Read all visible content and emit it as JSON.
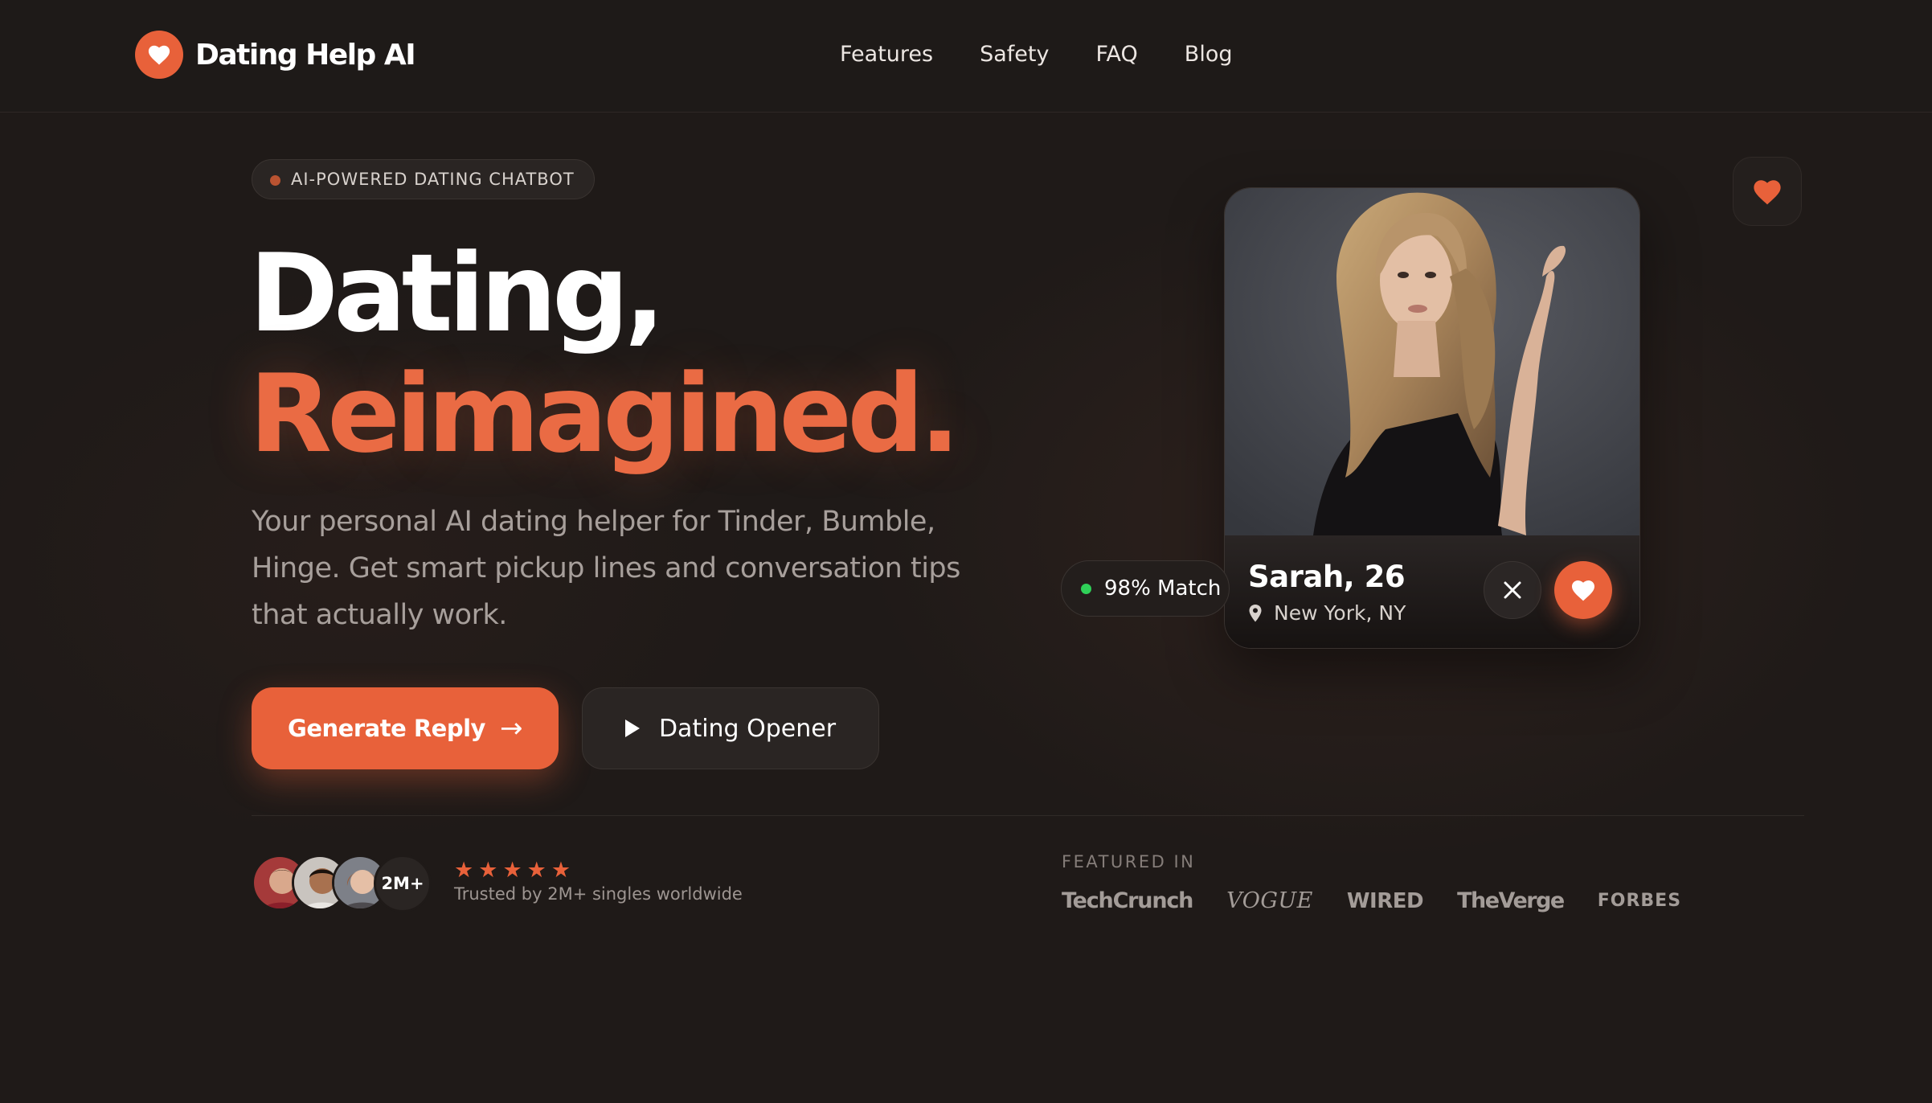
{
  "nav": {
    "brand": "Dating Help AI",
    "links": [
      "Features",
      "Safety",
      "FAQ",
      "Blog"
    ]
  },
  "hero": {
    "badge": "AI-POWERED DATING CHATBOT",
    "title_line1": "Dating,",
    "title_line2": "Reimagined.",
    "subtitle": "Your personal AI dating helper for Tinder, Bumble, Hinge. Get smart pickup lines and conversation tips that actually work.",
    "primary_cta": "Generate Reply",
    "secondary_cta": "Dating Opener"
  },
  "social_proof": {
    "count_badge": "2M+",
    "rating_stars": 5,
    "trusted_text": "Trusted by 2M+ singles worldwide"
  },
  "featured": {
    "label": "FEATURED IN",
    "brands": [
      "TechCrunch",
      "VOGUE",
      "WIRED",
      "TheVerge",
      "FORBES"
    ]
  },
  "profile_card": {
    "name_age": "Sarah, 26",
    "location": "New York, NY",
    "match": "98% Match"
  },
  "colors": {
    "accent": "#e8613a",
    "background": "#1f1a18",
    "online_dot": "#2fd058"
  },
  "icons": {
    "logo": "heart-icon",
    "secondary_cta": "play-icon",
    "location": "map-pin-icon",
    "pass": "close-icon",
    "like": "heart-icon",
    "float": "heart-icon",
    "rating": "star-icon"
  }
}
